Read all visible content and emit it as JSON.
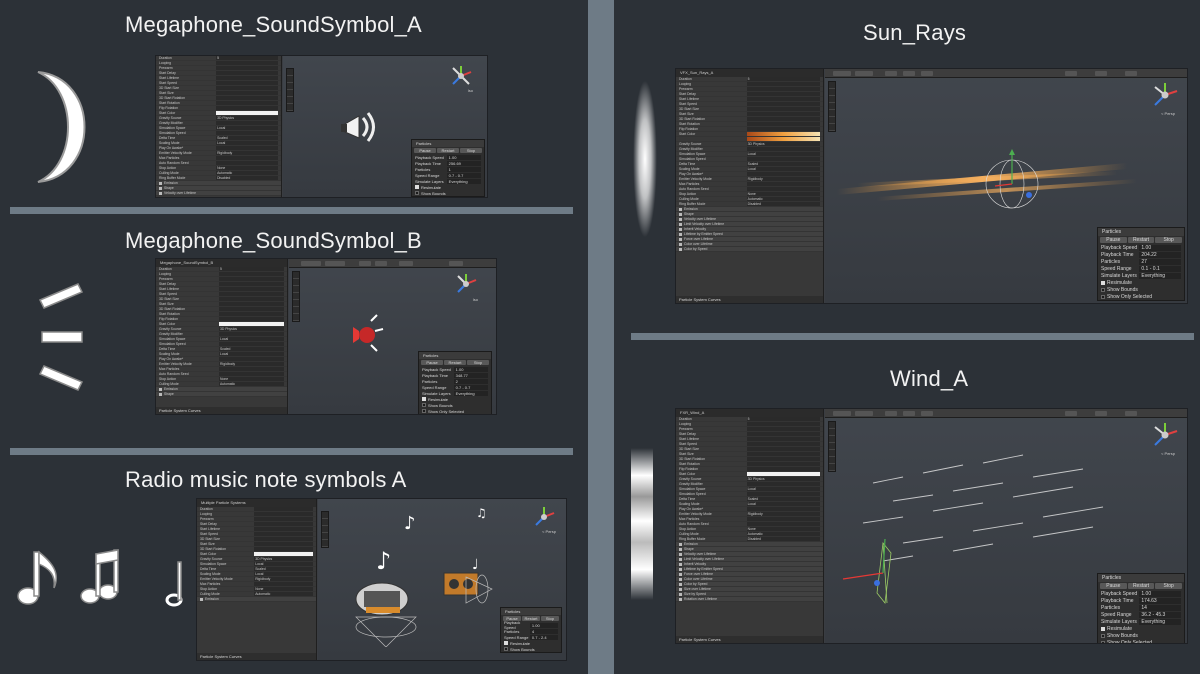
{
  "sections": {
    "megaphone_a": "Megaphone_SoundSymbol_A",
    "megaphone_b": "Megaphone_SoundSymbol_B",
    "radio": "Radio music note symbols A",
    "sun_rays": "Sun_Rays",
    "wind": "Wind_A"
  },
  "inspector": {
    "mega_b_title": "Megaphone_SoundSymbol_B",
    "radio_title": "Multiple Particle Systems",
    "sun_title": "VFX_Sun_Rays_A",
    "wind_title": "FXR_Wind_A",
    "curves_label": "Particle System Curves",
    "rows": [
      "Duration",
      "Looping",
      "Prewarm",
      "Start Delay",
      "Start Lifetime",
      "Start Speed",
      "3D Start Size",
      "Start Size",
      "3D Start Rotation",
      "Start Rotation",
      "Flip Rotation",
      "Start Color",
      "Gravity Source",
      "Gravity Modifier",
      "Simulation Space",
      "Simulation Speed",
      "Delta Time",
      "Scaling Mode",
      "Play On Awake*",
      "Emitter Velocity Mode",
      "Max Particles",
      "Auto Random Seed",
      "Stop Action",
      "Culling Mode",
      "Ring Buffer Mode"
    ],
    "modules": [
      "Emission",
      "Shape",
      "Velocity over Lifetime",
      "Limit Velocity over Lifetime",
      "Inherit Velocity",
      "Lifetime by Emitter Speed",
      "Force over Lifetime",
      "Color over Lifetime",
      "Color by Speed",
      "Size over Lifetime",
      "Size by Speed",
      "Rotation over Lifetime"
    ],
    "values": {
      "duration": "5",
      "gravity": "3D Physics",
      "space": "Local",
      "delta": "Scaled",
      "scaling": "Local",
      "emitter_mode": "Rigidbody",
      "stop": "None",
      "culling": "Automatic",
      "ring": "Disabled"
    }
  },
  "particles_panel": {
    "title": "Particles",
    "pause": "Pause",
    "restart": "Restart",
    "stop": "Stop",
    "playback_speed_label": "Playback Speed",
    "playback_time_label": "Playback Time",
    "particles_label": "Particles",
    "speed_range_label": "Speed Range",
    "simulate_layers_label": "Simulate Layers",
    "resimulate_label": "Resimulate",
    "show_bounds_label": "Show Bounds",
    "show_only_selected_label": "Show Only Selected",
    "everything": "Everything",
    "mega_a": {
      "playback_speed": "1.00",
      "playback_time": "256.69",
      "particles": "1",
      "speed_range": "0.7 - 0.7"
    },
    "mega_b": {
      "playback_speed": "1.00",
      "playback_time": "348.77",
      "particles": "2",
      "speed_range": "0.7 - 0.7"
    },
    "radio": {
      "playback_speed": "1.00",
      "playback_time": "",
      "particles": "4",
      "speed_range": "0.7 - 2.4"
    },
    "sun": {
      "playback_speed": "1.00",
      "playback_time": "204.22",
      "particles": "27",
      "speed_range": "0.1 - 0.1"
    },
    "wind": {
      "playback_speed": "1.00",
      "playback_time": "174.63",
      "particles": "14",
      "speed_range": "36.2 - 45.3"
    }
  },
  "viewport": {
    "persp": "< Persp",
    "iso": "Iso"
  },
  "colors": {
    "background": "#2c3137",
    "divider": "#6e7b86",
    "title": "#f2f2f2",
    "accent_orange": "#f0a040"
  },
  "icons": [
    "crescent-sound-wave-icon",
    "sound-lines-icon",
    "music-note-icons",
    "wind-streak-icon",
    "sun-ray-streak-icon",
    "scene-axis-gizmo-icon"
  ]
}
